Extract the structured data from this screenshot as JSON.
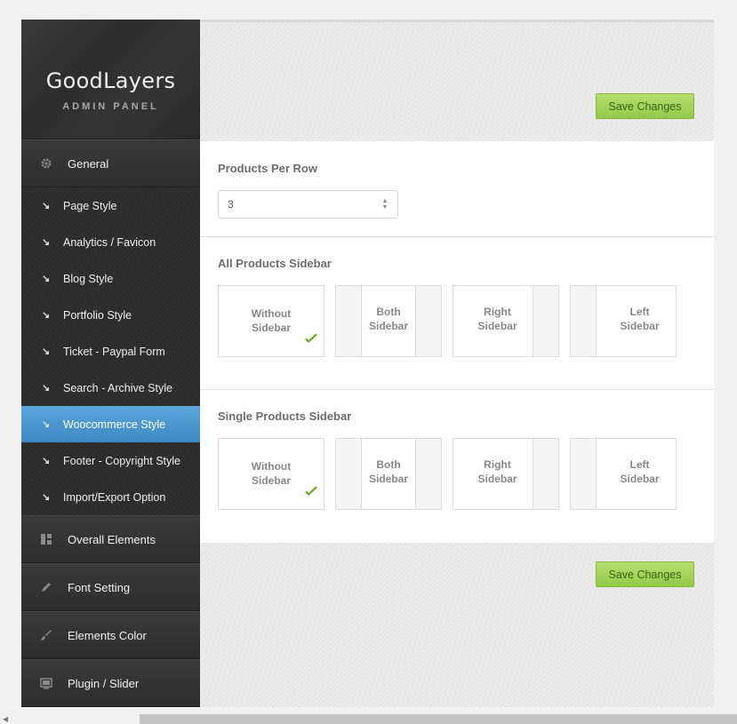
{
  "brand": {
    "title": "GoodLayers",
    "subtitle": "ADMIN PANEL"
  },
  "sidebar": {
    "general": {
      "label": "General",
      "icon": "gear-icon"
    },
    "sub_items": [
      {
        "label": "Page Style"
      },
      {
        "label": "Analytics / Favicon"
      },
      {
        "label": "Blog Style"
      },
      {
        "label": "Portfolio Style"
      },
      {
        "label": "Ticket - Paypal Form"
      },
      {
        "label": "Search - Archive Style"
      },
      {
        "label": "Woocommerce Style",
        "active": true
      },
      {
        "label": "Footer - Copyright Style"
      },
      {
        "label": "Import/Export Option"
      }
    ],
    "main_items": [
      {
        "label": "Overall Elements",
        "icon": "layout-icon"
      },
      {
        "label": "Font Setting",
        "icon": "pencil-icon"
      },
      {
        "label": "Elements Color",
        "icon": "brush-icon"
      },
      {
        "label": "Plugin / Slider",
        "icon": "slider-icon"
      }
    ]
  },
  "toolbar": {
    "save_label": "Save Changes"
  },
  "products_per_row": {
    "title": "Products Per Row",
    "value": "3"
  },
  "all_products_sidebar": {
    "title": "All Products Sidebar",
    "options": [
      {
        "line1": "Without",
        "line2": "Sidebar",
        "selected": true
      },
      {
        "line1": "Both",
        "line2": "Sidebar"
      },
      {
        "line1": "Right",
        "line2": "Sidebar"
      },
      {
        "line1": "Left",
        "line2": "Sidebar"
      }
    ]
  },
  "single_products_sidebar": {
    "title": "Single Products Sidebar",
    "options": [
      {
        "line1": "Without",
        "line2": "Sidebar",
        "selected": true
      },
      {
        "line1": "Both",
        "line2": "Sidebar"
      },
      {
        "line1": "Right",
        "line2": "Sidebar"
      },
      {
        "line1": "Left",
        "line2": "Sidebar"
      }
    ]
  },
  "colors": {
    "accent": "#4a97cf",
    "save_button": "#a5d45c",
    "check": "#6cae2c"
  }
}
